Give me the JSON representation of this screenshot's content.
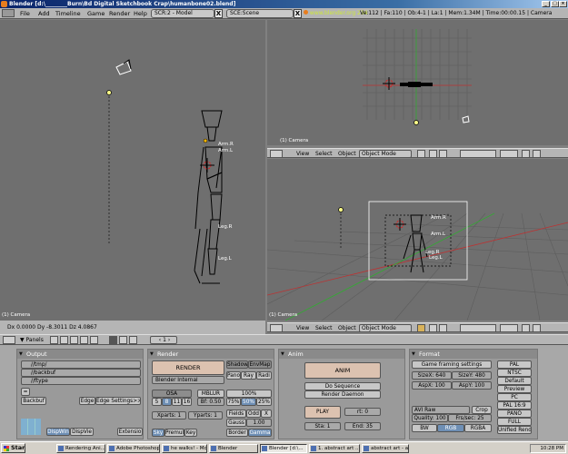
{
  "window": {
    "title": "Blender [d:\\________Burn\\Bd Digital Sketchbook Crap\\humanbone02.blend]"
  },
  "menubar": {
    "items": [
      "File",
      "Add",
      "Timeline",
      "Game",
      "Render",
      "Help"
    ],
    "screen_field": "SCR:2 - Model",
    "scene_field": "SCE:Scene",
    "url": "www.blender.org 234",
    "info": "Ve:112 | Fa:110 | Ob:4-1 | La:1 | Mem:1.34M | Time:00:00.15 | Camera"
  },
  "views": {
    "left": {
      "label": "(1) Camera",
      "coords": "Dx 0.0000   Dy -8.3011   Dz 4.0867",
      "bones": [
        "Arm.R",
        "Arm.L",
        "Leg.R",
        "Leg.L"
      ]
    },
    "top_right": {
      "label": "(1) Camera"
    },
    "bottom_right": {
      "label": "(1) Camera",
      "bones": [
        "Arm.R",
        "Arm.L",
        "Leg.R",
        "Leg.L"
      ]
    },
    "header": {
      "view": "View",
      "select": "Select",
      "object": "Object",
      "mode": "Object Mode"
    }
  },
  "buttons_header": {
    "panels": "Panels",
    "frame": "1"
  },
  "output": {
    "title": "Output",
    "paths": [
      "//tmp/",
      "//backbuf",
      "//ftype"
    ],
    "backbuf": "Backbuf",
    "edge": "Edge",
    "edge_settings": "Edge Settings>>",
    "disp_win": "DispWin",
    "disp_view": "DispVie",
    "extensions": "Extensio"
  },
  "render": {
    "title": "Render",
    "render_btn": "RENDER",
    "engine": "Blender Internal",
    "shadow": "Shadow",
    "envmap": "EnvMap",
    "pano": "Pano",
    "ray": "Ray",
    "radio": "Radi",
    "osa": "OSA",
    "osa_values": [
      "5",
      "8",
      "11",
      "16"
    ],
    "mblur": "MBLUR",
    "bf": "Bf: 0.50",
    "percent_values": [
      "100%",
      "75%",
      "50%",
      "25%"
    ],
    "xparts": "Xparts: 1",
    "yparts": "Yparts: 1",
    "fields": "Fields",
    "odd": "Odd",
    "x": "X",
    "gauss": "Gauss",
    "gauss_val": "1.00",
    "sky": "Sky",
    "premul": "Premul",
    "key": "Key",
    "border": "Border",
    "gamma": "Gamma"
  },
  "anim": {
    "title": "Anim",
    "anim_btn": "ANIM",
    "do_sequence": "Do Sequence",
    "render_daemon": "Render Daemon",
    "play": "PLAY",
    "rt": "rt: 0",
    "sta": "Sta: 1",
    "end": "End: 35"
  },
  "format": {
    "title": "Format",
    "game_framing": "Game framing settings",
    "sizex": "SizeX: 640",
    "sizey": "SizeY: 480",
    "aspx": "AspX: 100",
    "aspy": "AspY: 100",
    "codec": "AVI Raw",
    "crop": "Crop",
    "quality": "Quality: 100",
    "fps": "Frs/sec: 25",
    "bw": "BW",
    "rgb": "RGB",
    "rgba": "RGBA",
    "presets": [
      "PAL",
      "NTSC",
      "Default",
      "Preview",
      "PC",
      "PAL 16:9",
      "PANO",
      "FULL",
      "Unified Rend"
    ]
  },
  "taskbar": {
    "start": "Start",
    "tasks": [
      "Rendering Ani...",
      "Adobe Photoshop",
      "he walks! - Mo...",
      "Blender",
      "Blender [d:\\...",
      "1. abstract art ...",
      "abstract art - a..."
    ],
    "clock": "10:28 PM"
  }
}
